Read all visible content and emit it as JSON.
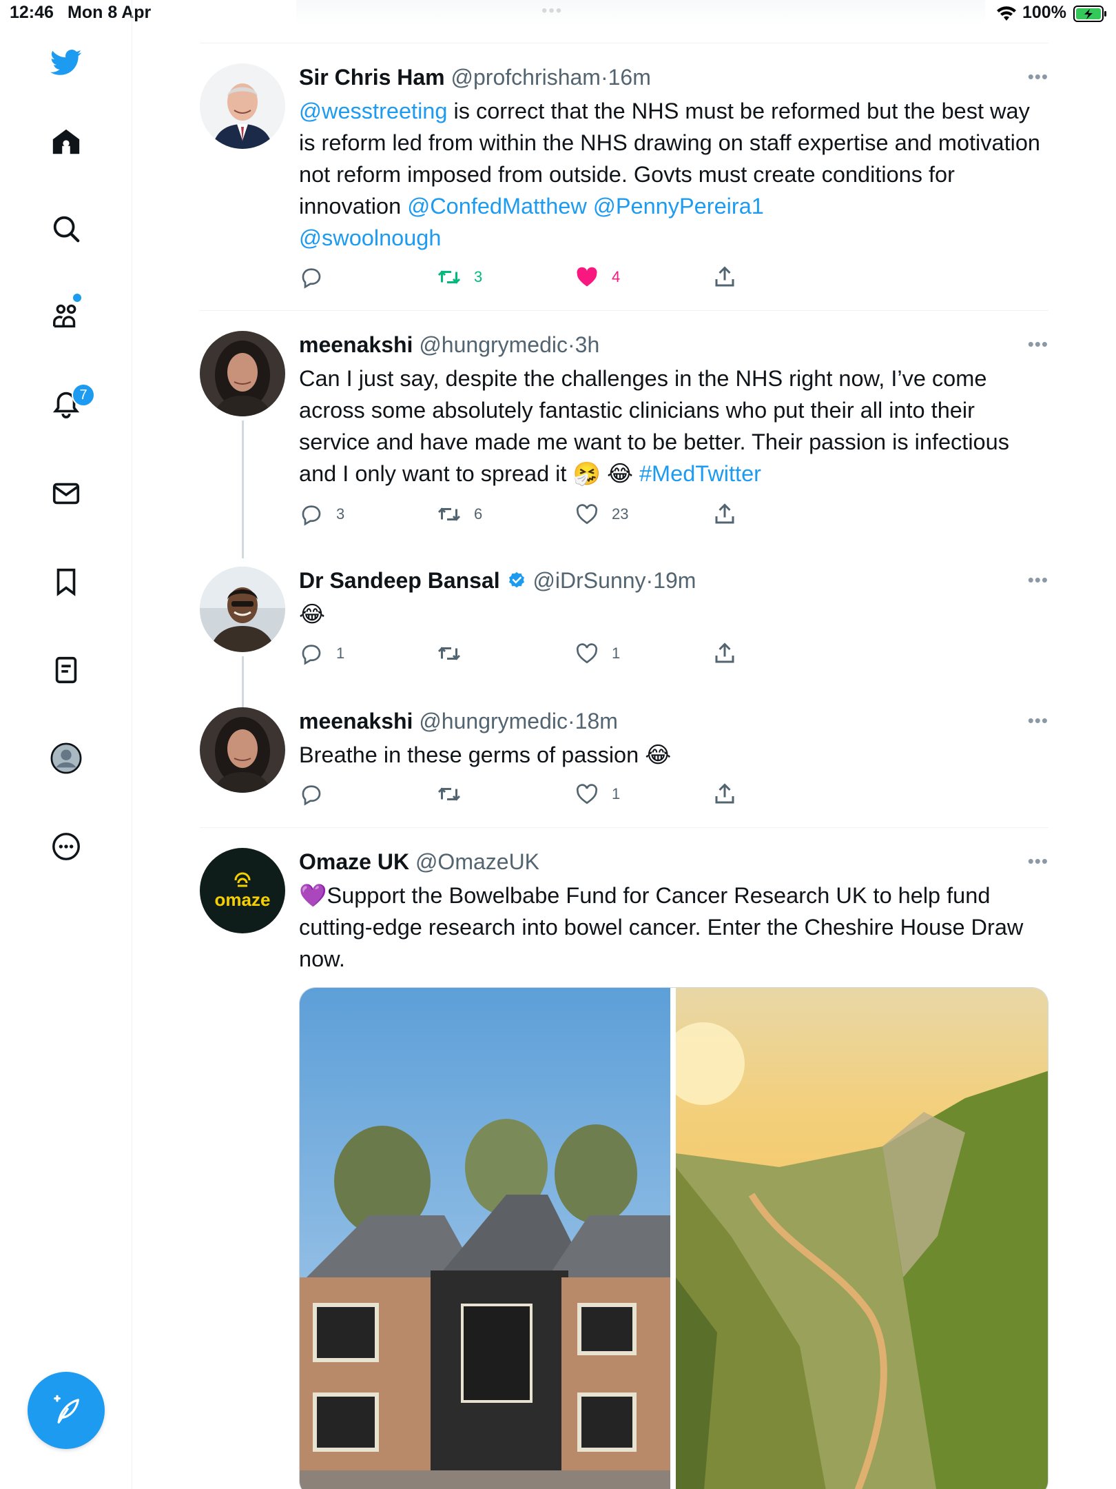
{
  "status_bar": {
    "time": "12:46",
    "date": "Mon 8 Apr",
    "battery": "100%"
  },
  "sidebar": {
    "notification_count": "7",
    "items": [
      "home-icon",
      "search-icon",
      "communities-icon",
      "notifications-icon",
      "messages-icon",
      "bookmarks-icon",
      "lists-icon",
      "profile-icon",
      "more-icon"
    ]
  },
  "colors": {
    "accent": "#1d9bf0",
    "retweet_active": "#00ba7c",
    "like_active": "#f91880",
    "muted": "#536471"
  },
  "tweets": [
    {
      "name": "Sir Chris Ham",
      "handle": "@profchrisham",
      "sep": "·",
      "time": "16m",
      "text_link1": "@wesstreeting",
      "text_part1": " is correct that the NHS must be reformed but the best way is reform led from within the NHS drawing on staff expertise and motivation not reform imposed from outside. Govts must create conditions for innovation ",
      "text_link2": "@ConfedMatthew",
      "text_link3": "@PennyPereira1",
      "text_link4": "@swoolnough",
      "replies": "",
      "retweets": "3",
      "likes": "4"
    },
    {
      "name": "meenakshi",
      "handle": "@hungrymedic",
      "sep": "·",
      "time": "3h",
      "text_part1": "Can I just say, despite the challenges in the NHS right now, I’ve come across some absolutely fantastic clinicians who put their all into their service and have made me want to be better. Their passion is infectious and I only want to spread it 🤧 😂 ",
      "text_link1": "#MedTwitter",
      "replies": "3",
      "retweets": "6",
      "likes": "23"
    },
    {
      "name": "Dr Sandeep Bansal",
      "handle": "@iDrSunny",
      "sep": "·",
      "time": "19m",
      "text_part1": "😂",
      "replies": "1",
      "retweets": "",
      "likes": "1"
    },
    {
      "name": "meenakshi",
      "handle": "@hungrymedic",
      "sep": "·",
      "time": "18m",
      "text_part1": "Breathe in these germs of passion 😂",
      "replies": "",
      "retweets": "",
      "likes": "1"
    },
    {
      "name": "Omaze UK",
      "handle": "@OmazeUK",
      "avatar_text": "omaze",
      "text_part1": "💜Support the Bowelbabe Fund for Cancer Research UK to help fund cutting-edge research into bowel cancer. Enter the Cheshire House Draw now."
    }
  ]
}
